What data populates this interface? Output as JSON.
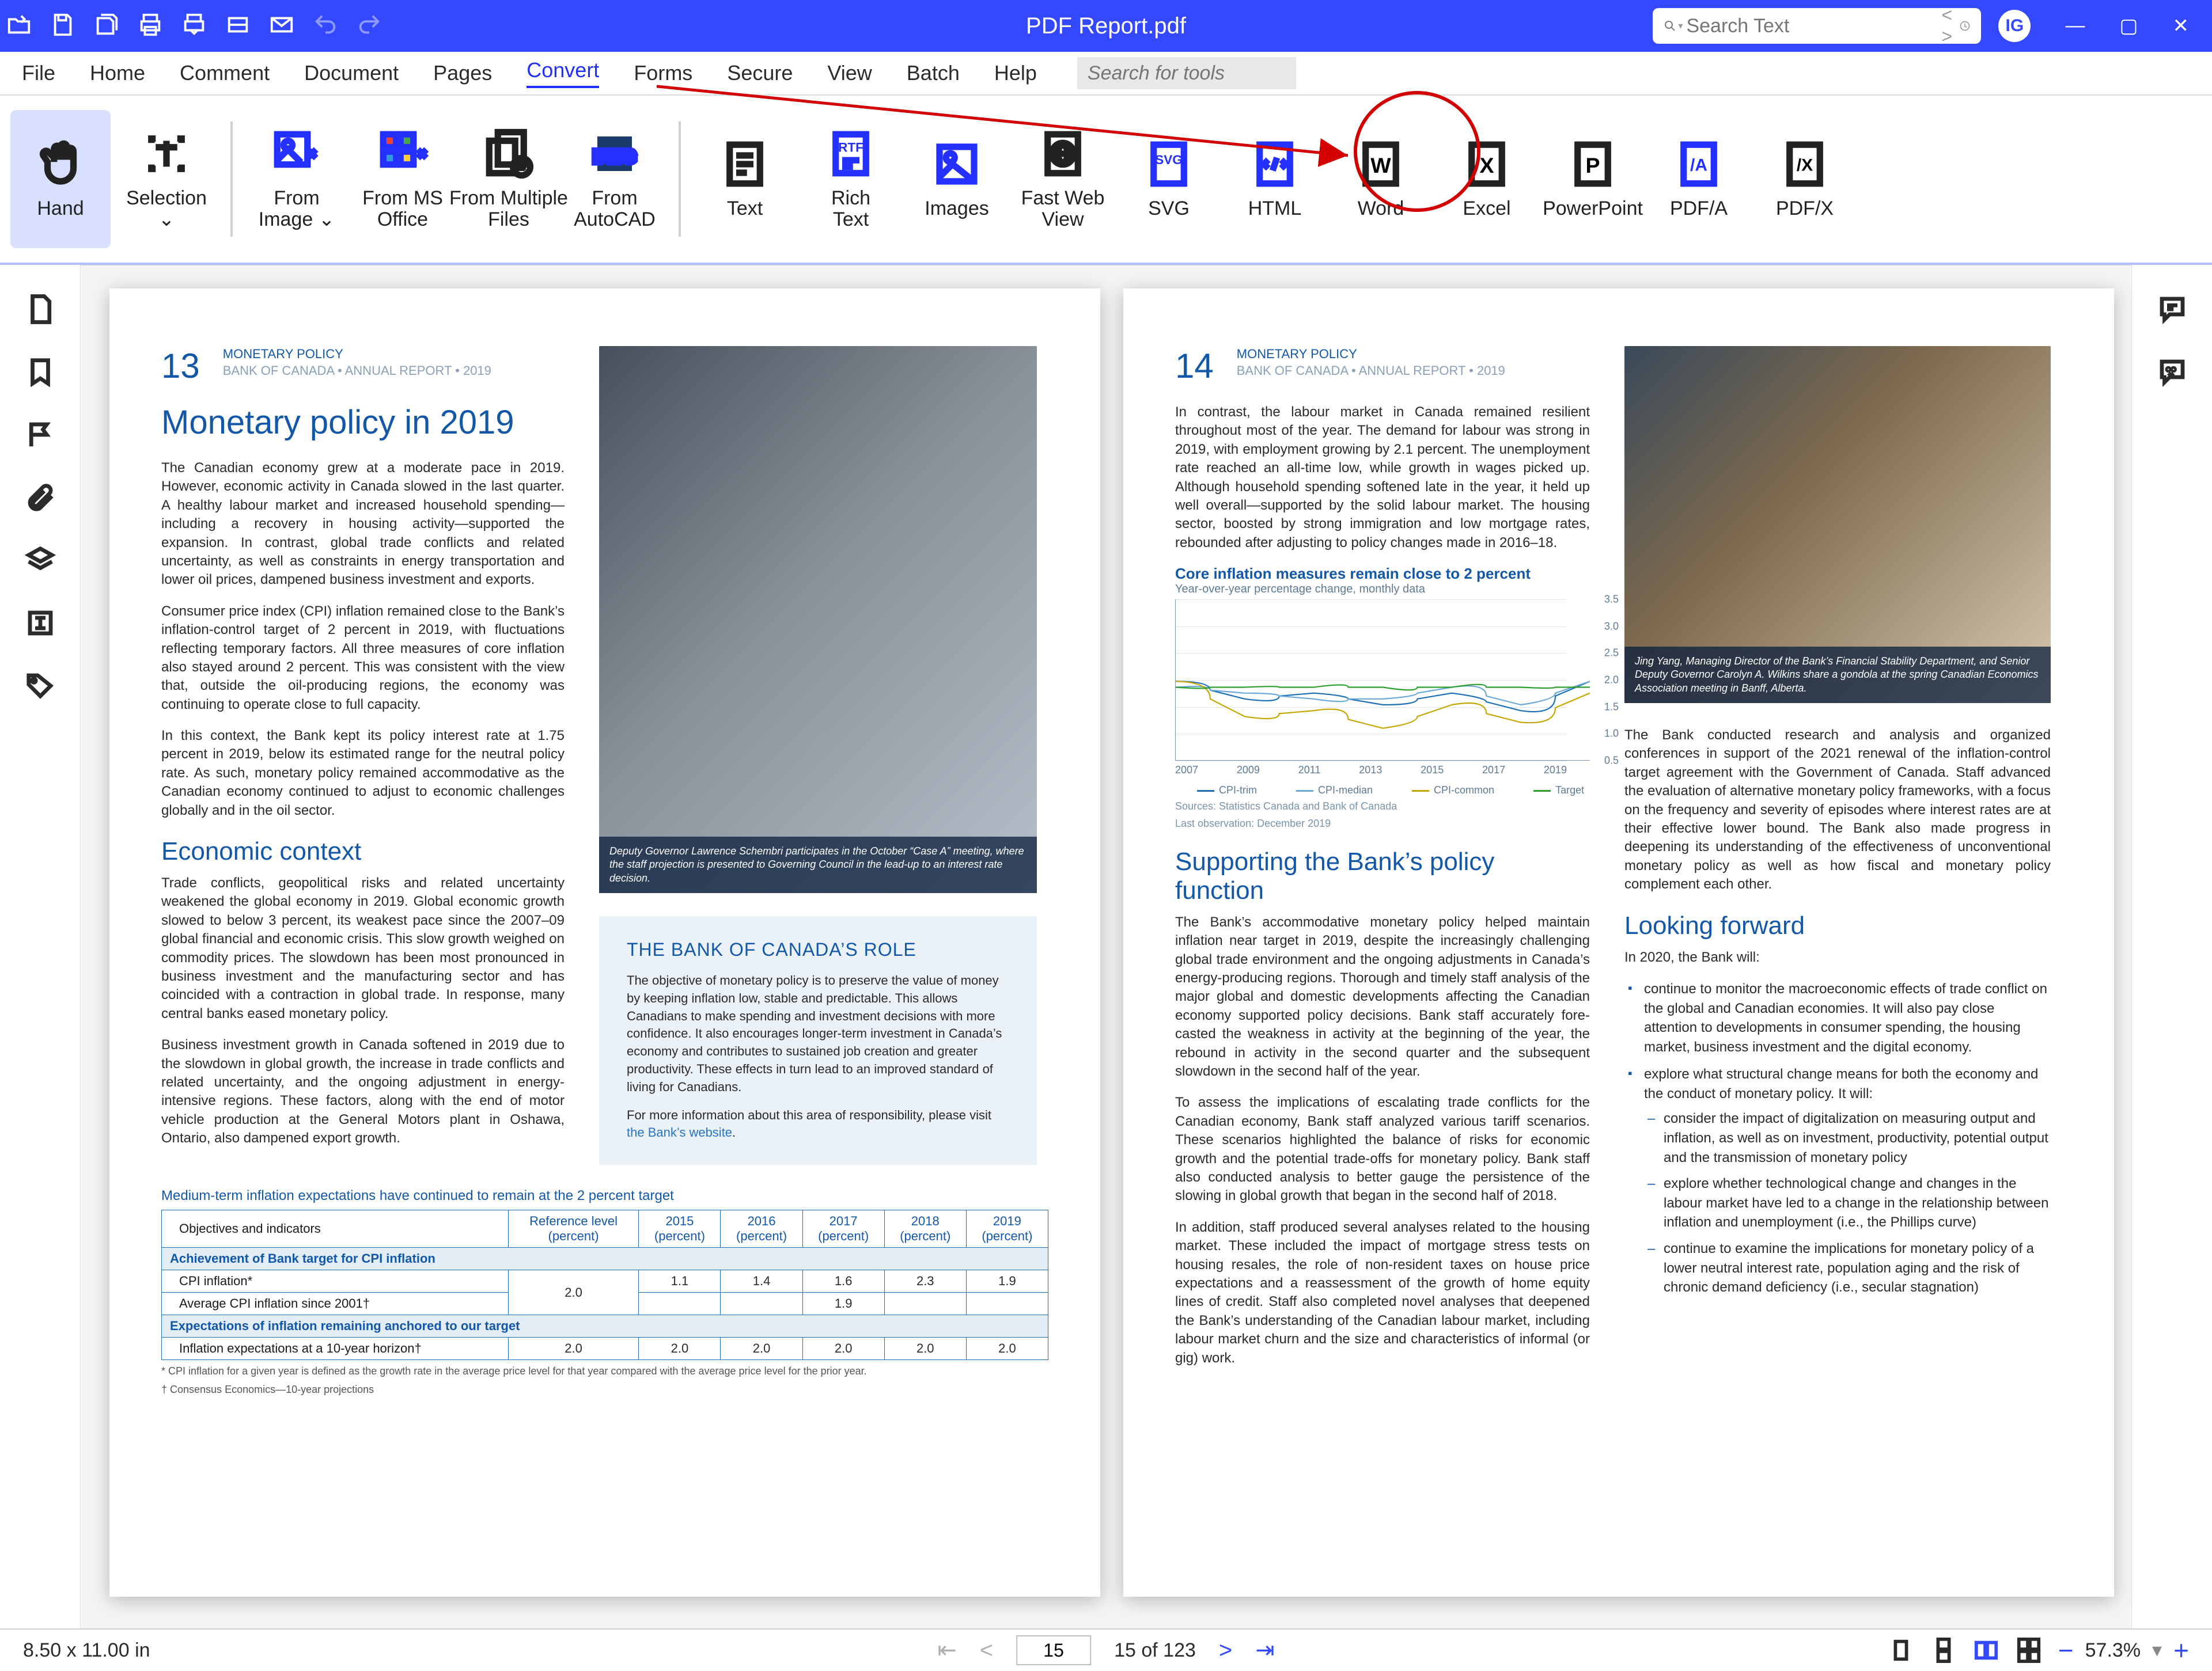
{
  "titlebar": {
    "title": "PDF Report.pdf",
    "search_ph": "Search Text",
    "user": "IG"
  },
  "menu": [
    "File",
    "Home",
    "Comment",
    "Document",
    "Pages",
    "Convert",
    "Forms",
    "Secure",
    "View",
    "Batch",
    "Help"
  ],
  "menu_selected": "Convert",
  "tool_search_ph": "Search for tools",
  "ribbon": [
    {
      "id": "hand",
      "label": "Hand",
      "sel": true
    },
    {
      "id": "selection",
      "label": "Selection\n⌄"
    },
    {
      "sep": true
    },
    {
      "id": "from-image",
      "label": "From\nImage ⌄",
      "blue": true
    },
    {
      "id": "from-ms",
      "label": "From MS\nOffice",
      "blue": true
    },
    {
      "id": "from-multi",
      "label": "From Multiple\nFiles"
    },
    {
      "id": "from-acad",
      "label": "From\nAutoCAD",
      "blue": true
    },
    {
      "sep": true
    },
    {
      "id": "text",
      "label": "Text"
    },
    {
      "id": "rtf",
      "label": "Rich\nText",
      "blue": true
    },
    {
      "id": "images",
      "label": "Images",
      "blue": true
    },
    {
      "id": "fastweb",
      "label": "Fast Web\nView"
    },
    {
      "id": "svg",
      "label": "SVG",
      "blue": true
    },
    {
      "id": "html",
      "label": "HTML",
      "blue": true
    },
    {
      "id": "word",
      "label": "Word"
    },
    {
      "id": "excel",
      "label": "Excel"
    },
    {
      "id": "ppt",
      "label": "PowerPoint"
    },
    {
      "id": "pdfa",
      "label": "PDF/A",
      "blue": true
    },
    {
      "id": "pdfx",
      "label": "PDF/X"
    }
  ],
  "status": {
    "dims": "8.50 x 11.00 in",
    "page": "15",
    "total": "15 of 123",
    "zoom": "57.3%"
  },
  "page13": {
    "num": "13",
    "crumb": "MONETARY POLICY",
    "crumb2": "BANK OF CANADA  •  ANNUAL REPORT  •  2019",
    "h1": "Monetary policy in 2019",
    "p1": "The Canadian economy grew at a moderate pace in 2019. However, economic activity in Canada slowed in the last quarter. A healthy labour market and increased household spending—including a recovery in housing activity—sup­ported the expansion. In contrast, global trade conflicts and related uncertainty, as well as constraints in energy transportation and lower oil prices, dampened business investment and exports.",
    "p2": "Consumer price index (CPI) inflation remained close to the Bank’s inflation-control target of 2 percent in 2019, with fluctua­tions reflecting temporary factors. All three measures of core inflation also stayed around 2 percent. This was consistent with the view that, outside the oil-producing regions, the economy was continuing to operate close to full capacity.",
    "p3": "In this context, the Bank kept its policy interest rate at 1.75 percent in 2019, below its estimated range for the neu­tral policy rate. As such, monetary policy remained accom­modative as the Canadian economy continued to adjust to economic challenges globally and in the oil sector.",
    "h2": "Economic context",
    "p4": "Trade conflicts, geopolitical risks and related uncertainty weakened the global economy in 2019. Global economic growth slowed to below 3 percent, its weakest pace since the 2007–09 global financial and economic crisis. This slow growth weighed on commodity prices. The slowdown has been most pronounced in business investment and the manufacturing sector and has coincided with a contraction in global trade. In response, many central banks eased monetary policy.",
    "p5": "Business investment growth in Canada softened in 2019 due to the slowdown in global growth, the increase in trade conflicts and related uncertainty, and the ongoing adjust­ment in energy-intensive regions. These factors, along with the end of motor vehicle production at the General Motors plant in Oshawa, Ontario, also dampened export growth.",
    "photo_cap": "Deputy Governor Lawrence Schembri participates in the October “Case A” meeting, where the staff projection is presented to Governing Council in the lead-up to an interest rate decision.",
    "box_ttl": "THE BANK OF CANADA’S ROLE",
    "box_p1": "The objective of monetary policy is to preserve the value of money by keeping inflation low, stable and predictable. This allows Canadians to make spending and investment decisions with more confidence. It also encourages longer-term investment in Canada’s economy and contributes to sustained job creation and greater productivity. These effects in turn lead to an improved standard of living for Canadians.",
    "box_p2a": "For more information about this area of responsibility, please visit ",
    "box_link": "the Bank’s website",
    "tbl_cap": "Medium-term inflation expectations have continued to remain at the 2 percent target",
    "tbl_h": [
      "Objectives and indicators",
      "Reference level\n(percent)",
      "2015\n(percent)",
      "2016\n(percent)",
      "2017\n(percent)",
      "2018\n(percent)",
      "2019\n(percent)"
    ],
    "tbl_sect1": "Achievement of Bank target for CPI inflation",
    "tbl_r1": [
      "CPI inflation*",
      "2.0",
      "1.1",
      "1.4",
      "1.6",
      "2.3",
      "1.9"
    ],
    "tbl_r2": [
      "Average CPI inflation since 2001†",
      "",
      "",
      "",
      "1.9",
      "",
      ""
    ],
    "tbl_sect2": "Expectations of inflation remaining anchored to our target",
    "tbl_r3": [
      "Inflation expectations at a 10-year horizon†",
      "2.0",
      "2.0",
      "2.0",
      "2.0",
      "2.0",
      "2.0"
    ],
    "fn1": "*  CPI inflation for a given year is defined as the growth rate in the average price level for that year compared with the average price level for the prior year.",
    "fn2": "†  Consensus Economics—10-year projections"
  },
  "page14": {
    "num": "14",
    "crumb": "MONETARY POLICY",
    "crumb2": "BANK OF CANADA  •  ANNUAL REPORT  •  2019",
    "p1": "In contrast, the labour market in Canada remained resilient throughout most of the year. The demand for labour was strong in 2019, with employment growing by 2.1 percent. The unemployment rate reached an all-time low, while growth in wages picked up. Although household spending softened late in the year, it held up well overall—supported by the solid labour market. The housing sector, boosted by strong immigration and low mortgage rates, rebounded after adjusting to policy changes made in 2016–18.",
    "chart_ttl": "Core inflation measures remain close to 2 percent",
    "chart_sub": "Year-over-year percentage change, monthly data",
    "legend": [
      "CPI-trim",
      "CPI-median",
      "CPI-common",
      "Target"
    ],
    "src1": "Sources: Statistics Canada and Bank of Canada",
    "src2": "Last observation: December 2019",
    "h2": "Supporting the Bank’s policy function",
    "p2": "The Bank’s accommodative monetary policy helped main­tain inflation near target in 2019, despite the increasingly challenging global trade environment and the ongoing adjustments in Canada’s energy-producing regions. Thorough and timely staff analysis of the major global and domestic developments affecting the Canadian economy supported policy decisions. Bank staff accurately fore­casted the weakness in activity at the beginning of the year, the rebound in activity in the second quarter and the subsequent slowdown in the second half of the year.",
    "p3": "To assess the implications of escalating trade conflicts for the Canadian economy, Bank staff analyzed various tariff scenarios. These scenarios highlighted the balance of risks for economic growth and the potential trade-offs for monetary policy. Bank staff also conducted analysis to better gauge the persistence of the slowing in global growth that began in the second half of 2018.",
    "p4": "In addition, staff produced several analyses related to the housing market. These included the impact of mortgage stress tests on housing resales, the role of non-resident taxes on house price expectations and a reassessment of the growth of home equity lines of credit. Staff also completed novel analyses that deepened the Bank’s understanding of the Canadian labour market, including labour market churn and the size and characteristics of informal (or gig) work.",
    "photo_cap": "Jing Yang, Managing Director of the Bank’s Financial Stability Department, and Senior Deputy Governor Carolyn A. Wilkins share a gondola at the spring Canadian Economics Association meeting in Banff, Alberta.",
    "p5": "The Bank conducted research and analysis and organ­ized conferences in support of the 2021 renewal of the inflation-control target agreement with the Government of Canada. Staff advanced the evaluation of alternative mon­etary policy frameworks, with a focus on the frequency and severity of episodes where interest rates are at their effective lower bound. The Bank also made progress in deepening its understanding of the effectiveness of unconventional monetary policy as well as how fiscal and monetary policy complement each other.",
    "h3": "Looking forward",
    "p6": "In 2020, the Bank will:",
    "b1": "continue to monitor the macroeconomic effects of trade conflict on the global and Canadian economies. It will also pay close attention to developments in consumer spending, the housing market, business investment and the digital economy.",
    "b2": "explore what structural change means for both the economy and the conduct of monetary policy. It will:",
    "b2a": "consider the impact of digitalization on measuring output and inflation, as well as on investment, pro­ductivity, potential output and the transmission of monetary policy",
    "b2b": "explore whether technological change and changes in the labour market have led to a change in the relationship between inflation and unemployment (i.e., the Phillips curve)",
    "b2c": "continue to examine the implications for monetary policy of a lower neutral interest rate, population aging and the risk of chronic demand deficiency (i.e., secular stagnation)"
  },
  "chart_data": {
    "type": "line",
    "title": "Core inflation measures remain close to 2 percent",
    "ylabel": "%",
    "ylim": [
      0.5,
      3.5
    ],
    "x": [
      2007,
      2009,
      2011,
      2013,
      2015,
      2017,
      2019
    ],
    "series": [
      {
        "name": "CPI-trim",
        "color": "#1a6fb8",
        "values": [
          2.1,
          1.8,
          1.9,
          1.7,
          1.9,
          1.6,
          2.1
        ]
      },
      {
        "name": "CPI-median",
        "color": "#6aa9d8",
        "values": [
          2.0,
          1.9,
          1.8,
          1.8,
          2.0,
          1.7,
          2.1
        ]
      },
      {
        "name": "CPI-common",
        "color": "#c6a500",
        "values": [
          2.1,
          1.5,
          1.6,
          1.3,
          1.7,
          1.4,
          1.9
        ]
      },
      {
        "name": "Target",
        "color": "#2aa02a",
        "values": [
          2.0,
          2.0,
          2.0,
          2.0,
          2.0,
          2.0,
          2.0
        ]
      }
    ]
  }
}
